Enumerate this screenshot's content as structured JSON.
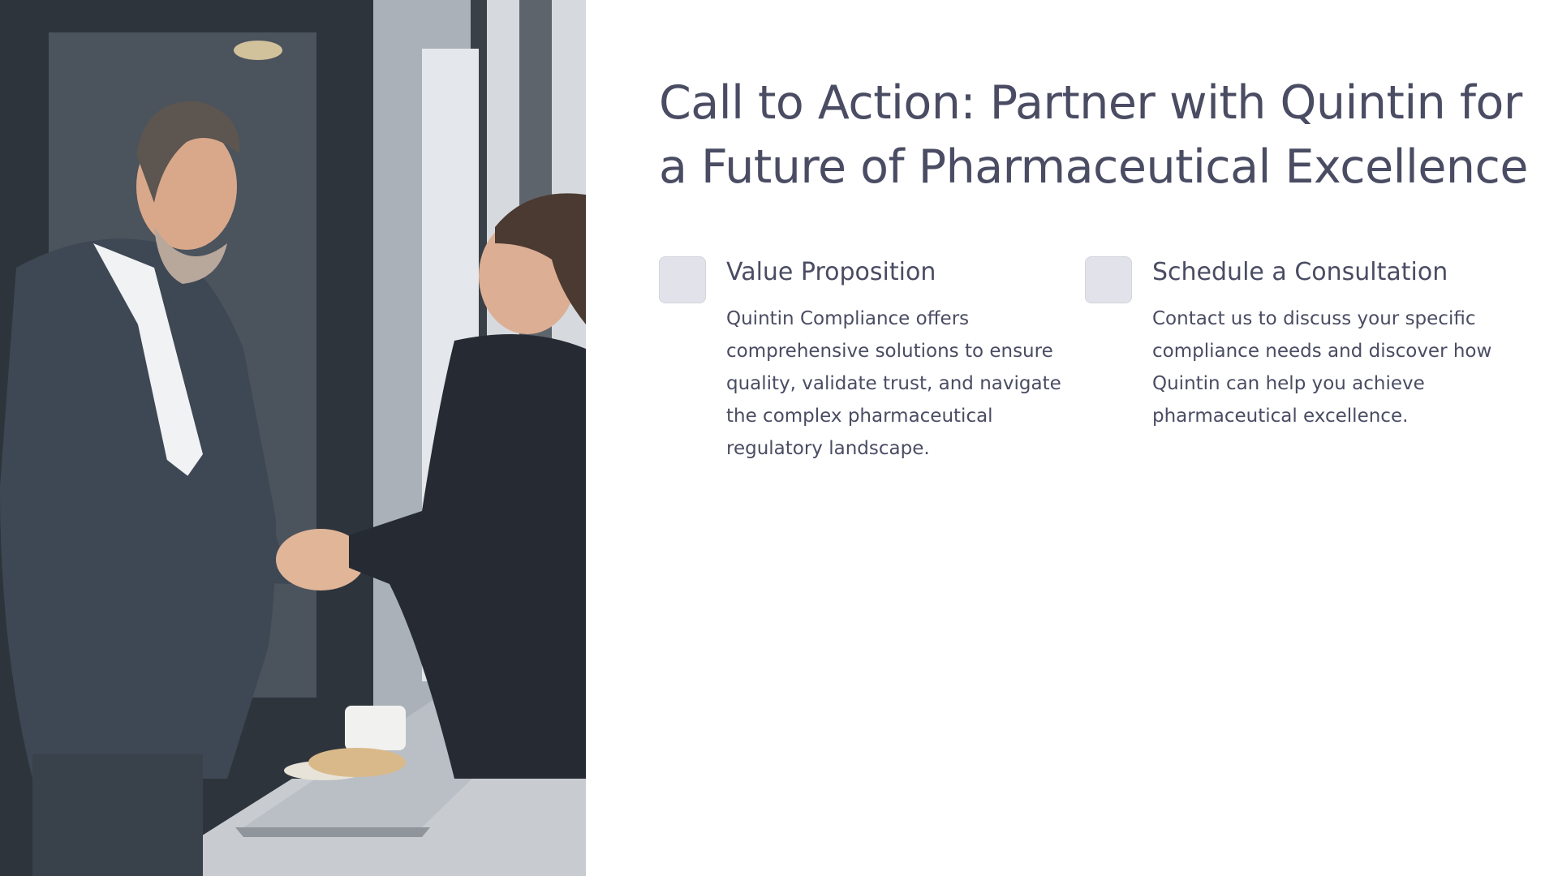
{
  "slide": {
    "title": "Call to Action: Partner with Quintin for a Future of Pharmaceutical Excellence",
    "image": {
      "icon": "handshake-photo",
      "description_tags": [
        "business-handshake",
        "office"
      ]
    },
    "cards": [
      {
        "heading": "Value Proposition",
        "body": "Quintin Compliance offers comprehensive solutions to ensure quality, validate trust, and navigate the complex pharmaceutical regulatory landscape."
      },
      {
        "heading": "Schedule a Consultation",
        "body": "Contact us to discuss your specific compliance needs and discover how Quintin can help you achieve pharmaceutical excellence."
      }
    ]
  },
  "colors": {
    "text": "#4a4c63",
    "icon_box": "#e2e3ea",
    "background": "#ffffff"
  }
}
